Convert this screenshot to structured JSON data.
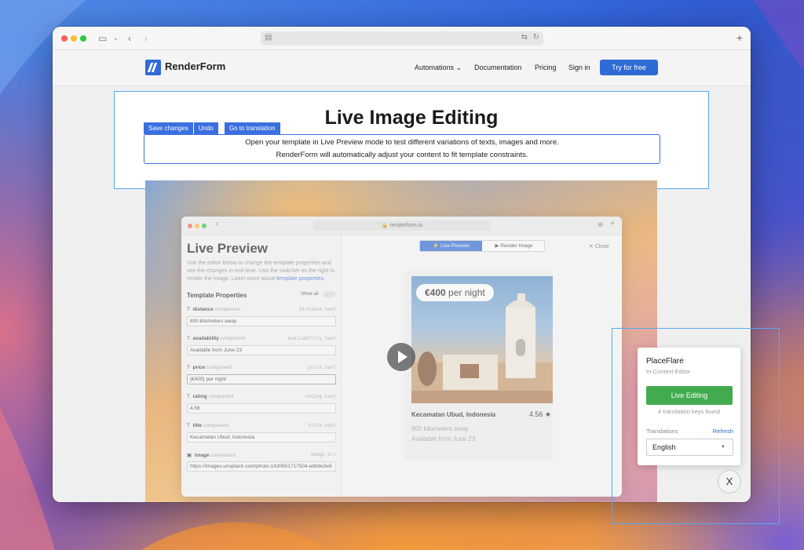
{
  "browser": {
    "url_icon": "page-icon",
    "plus": "+"
  },
  "nav": {
    "logo": "RenderForm",
    "items": [
      "Automations",
      "Documentation",
      "Pricing",
      "Sign in"
    ],
    "automations_caret": "⌄",
    "cta": "Try for free"
  },
  "hero": {
    "title": "Live Image Editing",
    "toolbar": [
      "Save changes",
      "Undo",
      "Go to translation"
    ],
    "desc_line1": "Open your template in Live Preview mode to test different variations of texts, images and more.",
    "desc_line2": "RenderForm will automatically adjust your content to fit template constraints."
  },
  "preview": {
    "url": "🔒 renderform.io",
    "title": "Live Preview",
    "desc": "Use the editor below to change the template properties and see the changes in real-time. Use the switcher on the right to render the image. Learn more about",
    "desc_link": "template properties.",
    "tp_head": "Template Properties",
    "show_all": "Show all",
    "fields": [
      {
        "name": "distance",
        "comp": " component",
        "key": "distance.text",
        "value": "800 kilometers away",
        "icon": "T"
      },
      {
        "name": "availability",
        "comp": " component",
        "key": "availability.text",
        "value": "Available from June 23",
        "icon": "T"
      },
      {
        "name": "price",
        "comp": " component",
        "key": "price.text",
        "value": "{€400} per night",
        "icon": "T"
      },
      {
        "name": "rating",
        "comp": " component",
        "key": "rating.text",
        "value": "4.56",
        "icon": "T"
      },
      {
        "name": "title",
        "comp": " component",
        "key": "title.text",
        "value": "Kecamatan Ubud, Indonesia",
        "icon": "T"
      },
      {
        "name": "image",
        "comp": " component",
        "key": "image.src",
        "value": "https://images.unsplash.com/photo-1430651717504-ebb9e3e6",
        "icon": "▣"
      }
    ],
    "tab_live": "⚡ Live Preview",
    "tab_render": "▶ Render Image",
    "close": "✕ Close",
    "card": {
      "price_bold": "€400",
      "price_rest": " per night",
      "location": "Kecamatan Ubud, Indonesia",
      "rating": "4.56 ★",
      "distance": "800 kilometers away",
      "availability": "Available from June 23"
    }
  },
  "placeflare": {
    "title": "PlaceFlare",
    "subtitle": "In-Context Editor",
    "button": "Live Editing",
    "keys": "4 translation keys found",
    "translations": "Translations",
    "refresh": "Refresh",
    "language": "English",
    "close": "X"
  },
  "colors": {
    "accent": "#2f6bd4",
    "live_editing": "#43ab4f",
    "frame": "#5aa8f0"
  }
}
